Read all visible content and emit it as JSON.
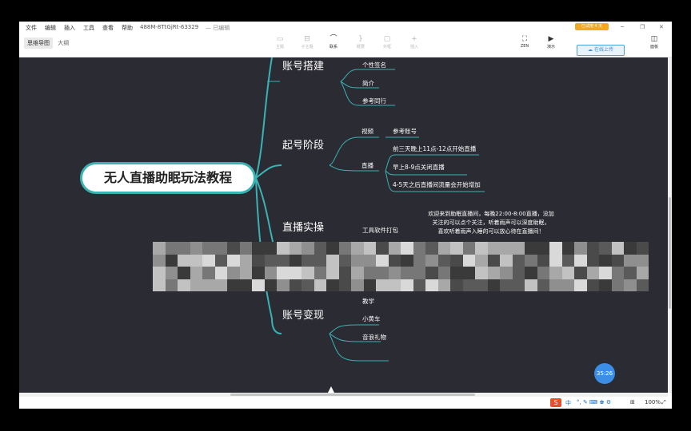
{
  "menubar": {
    "items": [
      "文件",
      "编辑",
      "插入",
      "工具",
      "查看",
      "帮助"
    ],
    "doc_title": "488M-8TtGjRt-63329",
    "save_status": "— 已编辑",
    "trial_badge": "已试用 4 天"
  },
  "toolbar": {
    "tabs": [
      "思维导图",
      "大纲"
    ],
    "tools": [
      {
        "label": "主题",
        "icon": "topic-icon"
      },
      {
        "label": "子主题",
        "icon": "subtopic-icon"
      },
      {
        "label": "联系",
        "icon": "relationship-icon"
      },
      {
        "label": "概要",
        "icon": "summary-icon"
      },
      {
        "label": "外框",
        "icon": "boundary-icon"
      },
      {
        "label": "插入",
        "icon": "plus-icon"
      }
    ],
    "zen_label": "ZEN",
    "present_label": "演示",
    "upload_label": "在线上传",
    "panel_label": "面板"
  },
  "mindmap": {
    "root": "无人直播助眠玩法教程",
    "branches": {
      "account_setup": {
        "label": "账号搭建",
        "children": [
          "个性签名",
          "简介",
          "参考同行"
        ]
      },
      "startup": {
        "label": "起号阶段",
        "video": {
          "label": "视频",
          "child": "参考账号"
        },
        "live": {
          "label": "直播",
          "children": [
            "前三天晚上11点-12点开始直播",
            "早上8-9点关闭直播",
            "4-5天之后直播间流量会开始增加"
          ]
        }
      },
      "live_ops": {
        "label": "直播实操",
        "tools": "工具软件打包",
        "notice": [
          "欢迎来到助眠直播间，每晚22:00-8:00直播，没加",
          "关注的可以点个关注，听着雨声可以深度助眠，",
          "喜欢听着雨声入睡的可以放心待在直播间！"
        ]
      },
      "monetize": {
        "label": "账号变现",
        "children": [
          "教学",
          "小黄车",
          "音浪礼物"
        ]
      }
    }
  },
  "statusbar": {
    "zoom": "100%",
    "timer": "35:26",
    "ime": "中"
  },
  "colors": {
    "canvas": "#2b2b33",
    "accent": "#3ab3b3",
    "badge": "#f5a623",
    "upload": "#3a8fd6"
  }
}
